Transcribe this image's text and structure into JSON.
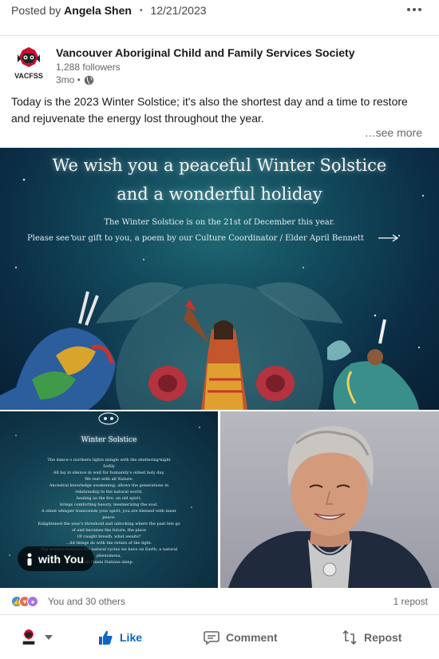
{
  "header": {
    "posted_by_prefix": "Posted by",
    "poster_name": "Angela Shen",
    "separator": "•",
    "date": "12/21/2023",
    "more_icon": "ellipsis-icon"
  },
  "actor": {
    "name": "Vancouver Aboriginal Child and Family Services Society",
    "followers": "1,288 followers",
    "time": "3mo •",
    "visibility_icon": "globe-icon",
    "logo_text": "VACFSS"
  },
  "post": {
    "commentary": "Today is the 2023 Winter Solstice; it's also the shortest day and a time to restore and rejuvenate the energy lost throughout the year.",
    "see_more": "…see more"
  },
  "banner": {
    "title_line1": "We wish you a peaceful Winter Solstice",
    "title_line2": "and a wonderful holiday",
    "sub_line1": "The Winter Solstice is on the 21st of December this year.",
    "sub_line2": "Please see our gift to you, a poem by our Culture Coordinator / Elder April Bennett"
  },
  "poem": {
    "title": "Winter Solstice",
    "lines": [
      "The dance o northern lights mingle with the sheltering night",
      "Softly",
      "All lay in silence in wait for humanity's oldest holy day,",
      "We rest with all Nature.",
      "Ancestral knowledge awakening, allows the generations in",
      "relationship to the natural world,",
      "healing as the fire, an old spirit,",
      "brings comforting beauty, mesmerizing the soul.",
      "A silent whisper transcends your spirit, you are blessed with inner",
      "peace.",
      "Enlightened the year's threshold and unlocking where the past lets go",
      "of and becomes the future, the place",
      "Of caught breath, what awaits?",
      "...ild things do with the return of the light.",
      "The solstice honours the natural cycles we have on Earth, a natural",
      "phenomena,",
      "all Plants Nations sleep."
    ],
    "tag_label": "with You",
    "tag_icon": "person-icon"
  },
  "social": {
    "reactions_text": "You and 30 others",
    "reposts": "1 repost",
    "reaction_icons": [
      "like-icon",
      "love-icon",
      "support-icon"
    ]
  },
  "actions": {
    "like": "Like",
    "comment": "Comment",
    "repost": "Repost"
  },
  "colors": {
    "accent": "#0a66c2",
    "banner_dark": "#0b2d45",
    "banner_teal": "#1f6a73"
  }
}
